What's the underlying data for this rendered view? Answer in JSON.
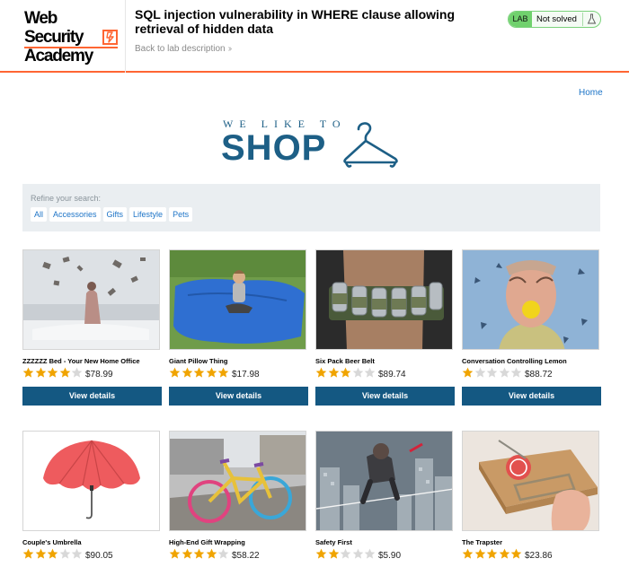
{
  "academy": {
    "logo_line1": "Web Security",
    "logo_line2": "Academy",
    "lab_title": "SQL injection vulnerability in WHERE clause allowing retrieval of hidden data",
    "back_link": "Back to lab description",
    "lab_badge": "LAB",
    "lab_status": "Not solved"
  },
  "nav": {
    "home": "Home"
  },
  "banner": {
    "tagline": "WE LIKE TO",
    "word": "SHOP"
  },
  "search": {
    "label": "Refine your search:",
    "filters": [
      "All",
      "Accessories",
      "Gifts",
      "Lifestyle",
      "Pets"
    ]
  },
  "colors": {
    "accent": "#ff6633",
    "brand": "#1d5f86",
    "button": "#145882",
    "star_on": "#f0a400",
    "star_off": "#d8d8d8"
  },
  "products": [
    {
      "name": "ZZZZZZ Bed - Your New Home Office",
      "price": "$78.99",
      "rating": 4,
      "image": "bedroom-books-image",
      "button": "View details"
    },
    {
      "name": "Giant Pillow Thing",
      "price": "$17.98",
      "rating": 5,
      "image": "blue-beanbag-image",
      "button": "View details"
    },
    {
      "name": "Six Pack Beer Belt",
      "price": "$89.74",
      "rating": 3,
      "image": "beer-belt-image",
      "button": "View details"
    },
    {
      "name": "Conversation Controlling Lemon",
      "price": "$88.72",
      "rating": 1,
      "image": "lemon-mouth-image",
      "button": "View details"
    },
    {
      "name": "Couple's Umbrella",
      "price": "$90.05",
      "rating": 3,
      "image": "red-umbrella-image"
    },
    {
      "name": "High-End Gift Wrapping",
      "price": "$58.22",
      "rating": 4,
      "image": "knitted-bicycle-image"
    },
    {
      "name": "Safety First",
      "price": "$5.90",
      "rating": 2,
      "image": "tightrope-city-image"
    },
    {
      "name": "The Trapster",
      "price": "$23.86",
      "rating": 5,
      "image": "mousetrap-image"
    }
  ]
}
